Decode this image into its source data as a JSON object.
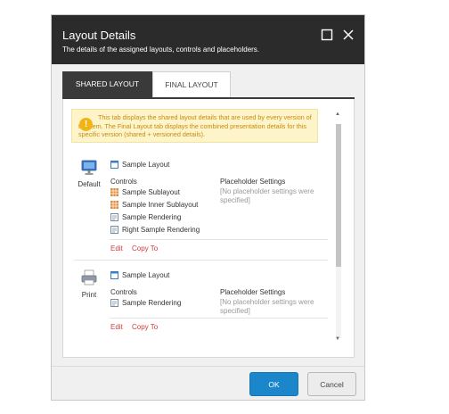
{
  "dialog": {
    "title": "Layout Details",
    "subtitle": "The details of the assigned layouts, controls and placeholders."
  },
  "tabs": [
    {
      "label": "SHARED LAYOUT",
      "active": true
    },
    {
      "label": "FINAL LAYOUT",
      "active": false
    }
  ],
  "notice": {
    "text": "This tab displays the shared layout details that are used by every version of the item. The Final Layout tab displays the combined presentation details for this specific version (shared + versioned details).",
    "icon": "warning-icon",
    "color": "#f2b317"
  },
  "devices": [
    {
      "name": "Default",
      "icon": "monitor-icon",
      "layout": "Sample Layout",
      "controls_label": "Controls",
      "controls": [
        {
          "label": "Sample Sublayout",
          "icon": "sublayout-icon"
        },
        {
          "label": "Sample Inner Sublayout",
          "icon": "sublayout-icon"
        },
        {
          "label": "Sample Rendering",
          "icon": "rendering-icon"
        },
        {
          "label": "Right Sample Rendering",
          "icon": "rendering-icon"
        }
      ],
      "placeholder_label": "Placeholder Settings",
      "placeholder_value": "[No placeholder settings were specified]",
      "edit_label": "Edit",
      "copy_label": "Copy To"
    },
    {
      "name": "Print",
      "icon": "printer-icon",
      "layout": "Sample Layout",
      "controls_label": "Controls",
      "controls": [
        {
          "label": "Sample Rendering",
          "icon": "rendering-icon"
        }
      ],
      "placeholder_label": "Placeholder Settings",
      "placeholder_value": "[No placeholder settings were specified]",
      "edit_label": "Edit",
      "copy_label": "Copy To"
    }
  ],
  "buttons": {
    "ok": "OK",
    "cancel": "Cancel"
  },
  "colors": {
    "header": "#2b2b2b",
    "primary": "#1b86c9",
    "link": "#d43c3c",
    "notice_bg": "#fdf4c9"
  }
}
